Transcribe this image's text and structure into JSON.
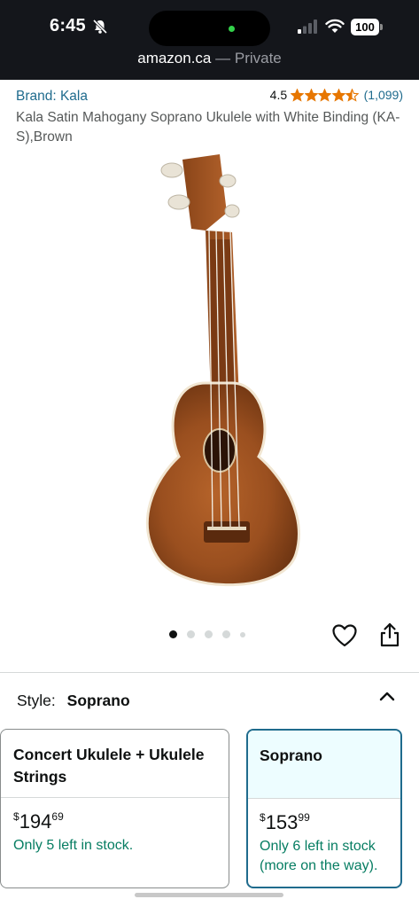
{
  "status_bar": {
    "time": "6:45",
    "battery": "100"
  },
  "browser": {
    "domain": "amazon.ca",
    "mode": " — Private"
  },
  "product": {
    "brand": "Brand: Kala",
    "rating": "4.5",
    "rating_stars": 4.5,
    "rating_count": "(1,099)",
    "title": "Kala Satin Mahogany Soprano Ukulele with White Binding (KA-S),Brown"
  },
  "carousel": {
    "total_dots": 5,
    "active_index": 0
  },
  "style": {
    "label": "Style:",
    "value": "Soprano"
  },
  "variants": [
    {
      "name": "Concert Ukulele + Ukulele Strings",
      "price_currency": "$",
      "price_whole": "194",
      "price_fraction": "69",
      "stock": "Only 5 left in stock.",
      "selected": false
    },
    {
      "name": "Soprano",
      "price_currency": "$",
      "price_whole": "153",
      "price_fraction": "99",
      "stock": "Only 6 left in stock (more on the way).",
      "selected": true
    }
  ],
  "colors": {
    "link": "#1f6b8d",
    "star": "#e77600",
    "in_stock": "#067d62",
    "selected_border": "#1f6b8d"
  }
}
